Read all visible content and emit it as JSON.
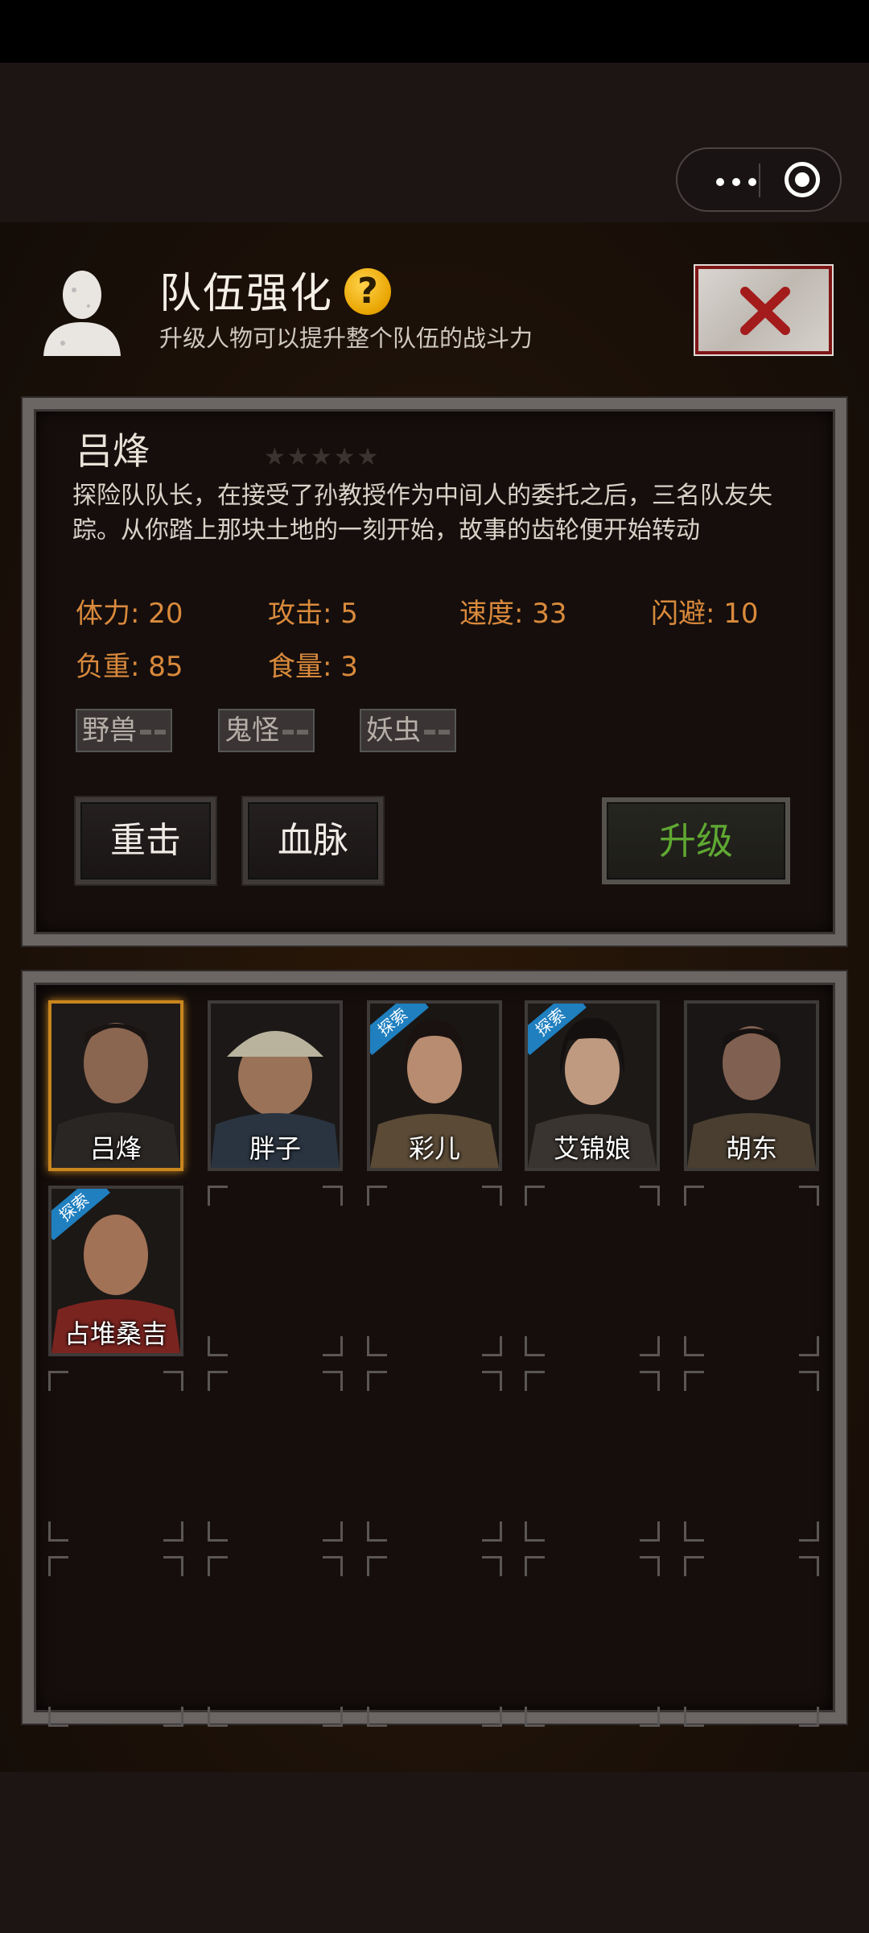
{
  "header": {
    "title": "队伍强化",
    "help_icon": "?",
    "subtitle": "升级人物可以提升整个队伍的战斗力"
  },
  "character": {
    "name": "吕烽",
    "stars": "★★★★★",
    "star_rating": 0,
    "description": "探险队队长，在接受了孙教授作为中间人的委托之后，三名队友失踪。从你踏上那块土地的一刻开始，故事的齿轮便开始转动",
    "stats": [
      {
        "label": "体力: 20"
      },
      {
        "label": "攻击: 5"
      },
      {
        "label": "速度: 33"
      },
      {
        "label": "闪避: 10"
      },
      {
        "label": "负重: 85"
      },
      {
        "label": "食量: 3"
      }
    ],
    "tags": [
      "野兽",
      "鬼怪",
      "妖虫"
    ],
    "buttons": {
      "strike": "重击",
      "bloodline": "血脉",
      "upgrade": "升级"
    }
  },
  "roster": [
    {
      "name": "吕烽",
      "badge": "",
      "selected": true
    },
    {
      "name": "胖子",
      "badge": ""
    },
    {
      "name": "彩儿",
      "badge": "探索"
    },
    {
      "name": "艾锦娘",
      "badge": "探索"
    },
    {
      "name": "胡东",
      "badge": ""
    },
    {
      "name": "占堆桑吉",
      "badge": "探索"
    }
  ],
  "colors": {
    "stat": "#d98a3c",
    "upgrade": "#5fa832",
    "selected_border": "#c8861e",
    "badge": "#1f7fbf",
    "close_x": "#a31b1b"
  }
}
